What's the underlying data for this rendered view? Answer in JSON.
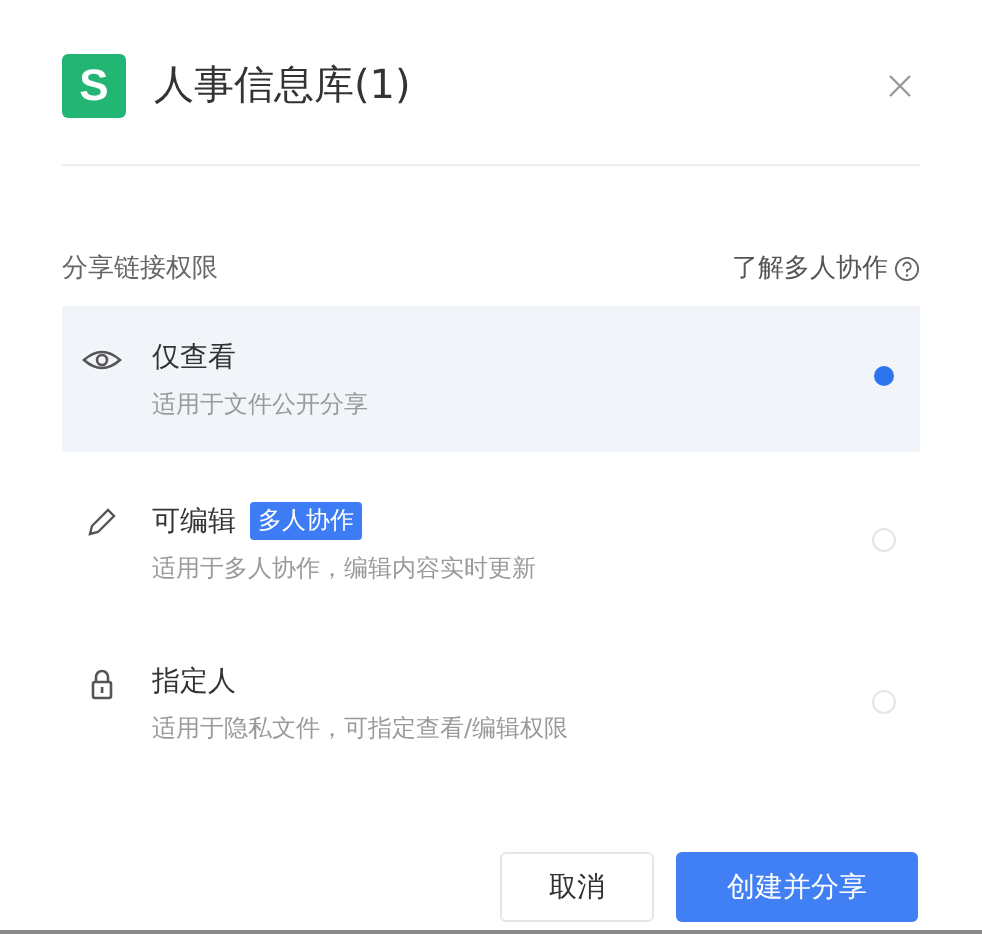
{
  "header": {
    "logo": "S",
    "title": "人事信息库(1)"
  },
  "section": {
    "label": "分享链接权限",
    "help_link": "了解多人协作"
  },
  "options": [
    {
      "kind": "view",
      "title": "仅查看",
      "description": "适用于文件公开分享",
      "selected": true
    },
    {
      "kind": "edit",
      "title": "可编辑",
      "badge": "多人协作",
      "description": "适用于多人协作，编辑内容实时更新",
      "selected": false
    },
    {
      "kind": "lock",
      "title": "指定人",
      "description": "适用于隐私文件，可指定查看/编辑权限",
      "selected": false
    }
  ],
  "buttons": [
    {
      "kind": "secondary",
      "label": "取消"
    },
    {
      "kind": "primary",
      "label": "创建并分享"
    }
  ]
}
